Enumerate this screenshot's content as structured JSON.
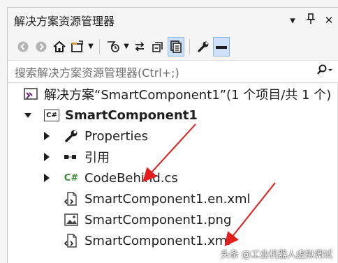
{
  "window": {
    "title": "解决方案资源管理器",
    "dropdown_glyph": "▾",
    "pin_glyph": "ᅮ",
    "close_glyph": "✕"
  },
  "search": {
    "placeholder": "搜索解决方案资源管理器(Ctrl+;)",
    "icon_glyph": "⚲",
    "dropdown_glyph": "▾"
  },
  "tree": {
    "solution_label": "解决方案“SmartComponent1”(1 个项目/共 1 个)",
    "project_label": "SmartComponent1",
    "items": [
      {
        "label": "Properties"
      },
      {
        "label": "引用"
      },
      {
        "label": "CodeBehind.cs"
      },
      {
        "label": "SmartComponent1.en.xml"
      },
      {
        "label": "SmartComponent1.png"
      },
      {
        "label": "SmartComponent1.xml"
      }
    ],
    "csharp_tag": "C#"
  },
  "watermark": "头条 @工业机器人虚拟调试",
  "colors": {
    "accent": "#cde0f7",
    "arrow": "#e41c1c",
    "csharp_green": "#388a34"
  }
}
